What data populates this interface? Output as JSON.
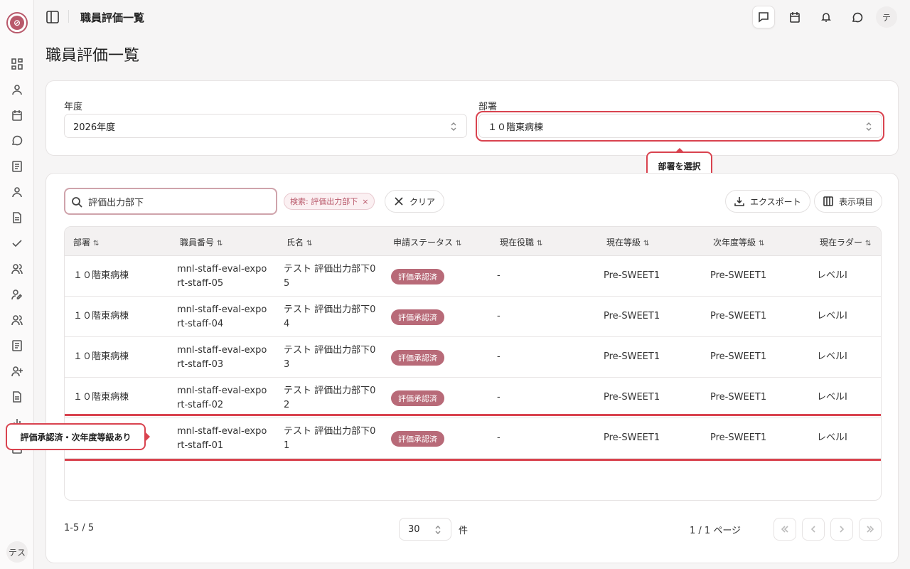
{
  "sidebar": {
    "logo_icon": "compass-icon",
    "icons": [
      "dashboard-icon",
      "user-icon",
      "calendar-icon",
      "message-icon",
      "list-icon",
      "user-icon",
      "document-icon",
      "check-icon",
      "users-icon",
      "user-edit-icon",
      "users-icon",
      "list-icon",
      "user-plus-icon",
      "document-icon",
      "chart-icon",
      "list-icon"
    ],
    "avatar": "テス"
  },
  "header": {
    "title": "職員評価一覧",
    "icons": [
      "chat-square-icon",
      "calendar-icon",
      "bell-icon",
      "chat-bubble-icon"
    ],
    "avatar": "テ"
  },
  "page_title": "職員評価一覧",
  "filters": {
    "year_label": "年度",
    "year_value": "2026年度",
    "dept_label": "部署",
    "dept_value": "１０階東病棟"
  },
  "callouts": {
    "dept": "部署を選択",
    "row": "評価承認済・次年度等級あり"
  },
  "toolbar": {
    "search_value": "評価出力部下",
    "chip_label": "検索: 評価出力部下",
    "chip_close": "×",
    "clear_label": "クリア",
    "export_label": "エクスポート",
    "columns_label": "表示項目"
  },
  "table": {
    "columns": [
      "部署",
      "職員番号",
      "氏名",
      "申請ステータス",
      "現在役職",
      "現在等級",
      "次年度等級",
      "現在ラダー"
    ],
    "sort_glyph": "⇅",
    "rows": [
      {
        "dept": "１０階東病棟",
        "id_1": "mnl-staff-eval-expo",
        "id_2": "rt-staff-05",
        "name_1": "テスト 評価出力部下0",
        "name_2": "5",
        "status": "評価承認済",
        "position": "-",
        "grade": "Pre-SWEET1",
        "next_grade": "Pre-SWEET1",
        "ladder": "レベルI"
      },
      {
        "dept": "１０階東病棟",
        "id_1": "mnl-staff-eval-expo",
        "id_2": "rt-staff-04",
        "name_1": "テスト 評価出力部下0",
        "name_2": "4",
        "status": "評価承認済",
        "position": "-",
        "grade": "Pre-SWEET1",
        "next_grade": "Pre-SWEET1",
        "ladder": "レベルI"
      },
      {
        "dept": "１０階東病棟",
        "id_1": "mnl-staff-eval-expo",
        "id_2": "rt-staff-03",
        "name_1": "テスト 評価出力部下0",
        "name_2": "3",
        "status": "評価承認済",
        "position": "-",
        "grade": "Pre-SWEET1",
        "next_grade": "Pre-SWEET1",
        "ladder": "レベルI"
      },
      {
        "dept": "１０階東病棟",
        "id_1": "mnl-staff-eval-expo",
        "id_2": "rt-staff-02",
        "name_1": "テスト 評価出力部下0",
        "name_2": "2",
        "status": "評価承認済",
        "position": "-",
        "grade": "Pre-SWEET1",
        "next_grade": "Pre-SWEET1",
        "ladder": "レベルI"
      },
      {
        "dept": "",
        "id_1": "mnl-staff-eval-expo",
        "id_2": "rt-staff-01",
        "name_1": "テスト 評価出力部下0",
        "name_2": "1",
        "status": "評価承認済",
        "position": "-",
        "grade": "Pre-SWEET1",
        "next_grade": "Pre-SWEET1",
        "ladder": "レベルI"
      }
    ]
  },
  "pagination": {
    "count": "1-5 / 5",
    "per_page": "30",
    "per_page_unit": "件",
    "page_info": "1 / 1 ページ"
  },
  "colors": {
    "accent": "#b9596b",
    "badge": "#b86a78",
    "highlight": "#d9434f"
  }
}
